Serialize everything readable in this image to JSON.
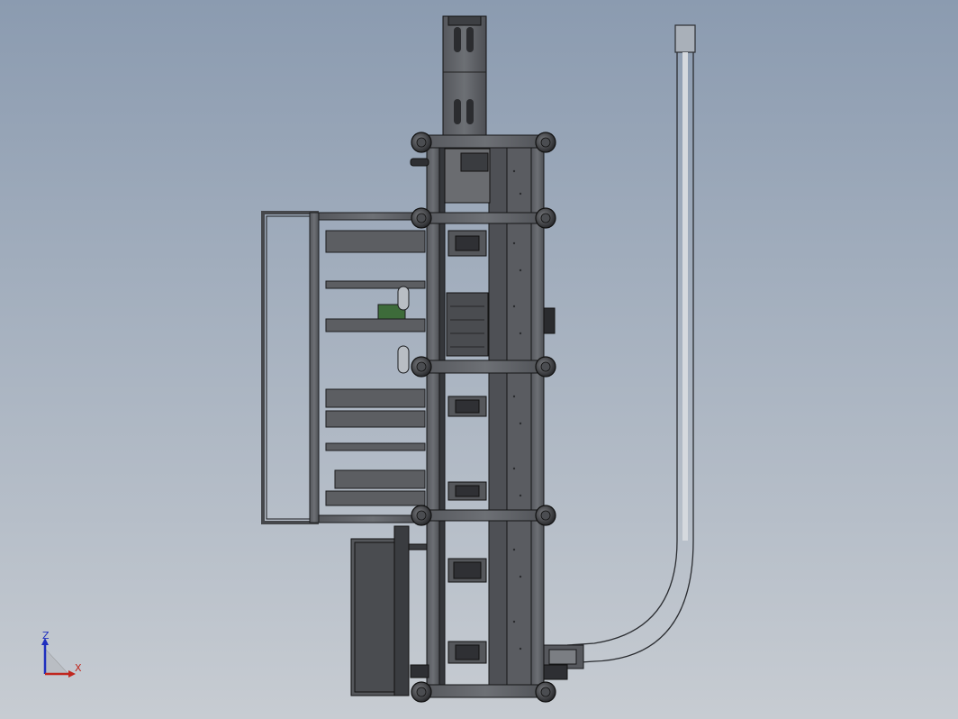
{
  "viewport": {
    "background_top": "#8b9bb0",
    "background_bottom": "#c7ccd2",
    "model_color": "#5f6166",
    "model_edge_color": "#1c1c1e",
    "accent_green": "#3d6b3a"
  },
  "triad": {
    "z_label": "Z",
    "x_label": "X",
    "z_color": "#1f2fbf",
    "x_color": "#c0271f"
  }
}
